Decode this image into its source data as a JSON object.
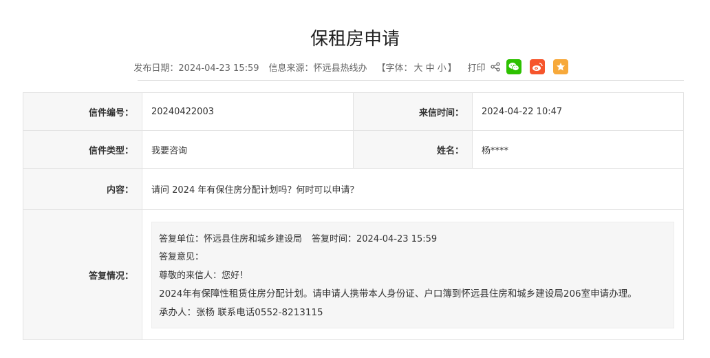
{
  "page_title": "保租房申请",
  "meta": {
    "publish": "发布日期：2024-04-23 15:59",
    "source": "信息来源：怀远县热线办",
    "font_prefix": "【字体：",
    "font_large": "大",
    "font_medium": "中",
    "font_small": "小",
    "font_suffix": "】",
    "print": "打印"
  },
  "icons": {
    "share": "share-icon",
    "wechat": "wechat-icon",
    "weibo": "weibo-icon",
    "favorite": "star-icon"
  },
  "colors": {
    "wechat": "#2dc100",
    "weibo": "#f6552c",
    "favorite": "#f7a93b"
  },
  "letter": {
    "number_label": "信件编号：",
    "number": "20240422003",
    "time_label": "来信时间：",
    "time": "2024-04-22 10:47",
    "type_label": "信件类型：",
    "type": "我要咨询",
    "name_label": "姓名：",
    "name": "杨****",
    "content_label": "内容：",
    "content": "请问 2024 年有保住房分配计划吗？何时可以申请？",
    "reply_label": "答复情况："
  },
  "reply": {
    "unit": "答复单位：怀远县住房和城乡建设局",
    "time": "答复时间：2024-04-23 15:59",
    "opinion": "答复意见：",
    "greeting": "尊敬的来信人：您好！",
    "body": "2024年有保障性租赁住房分配计划。请申请人携带本人身份证、户口簿到怀远县住房和城乡建设局206室申请办理。",
    "handler": "承办人：张杨  联系电话0552-8213115"
  }
}
